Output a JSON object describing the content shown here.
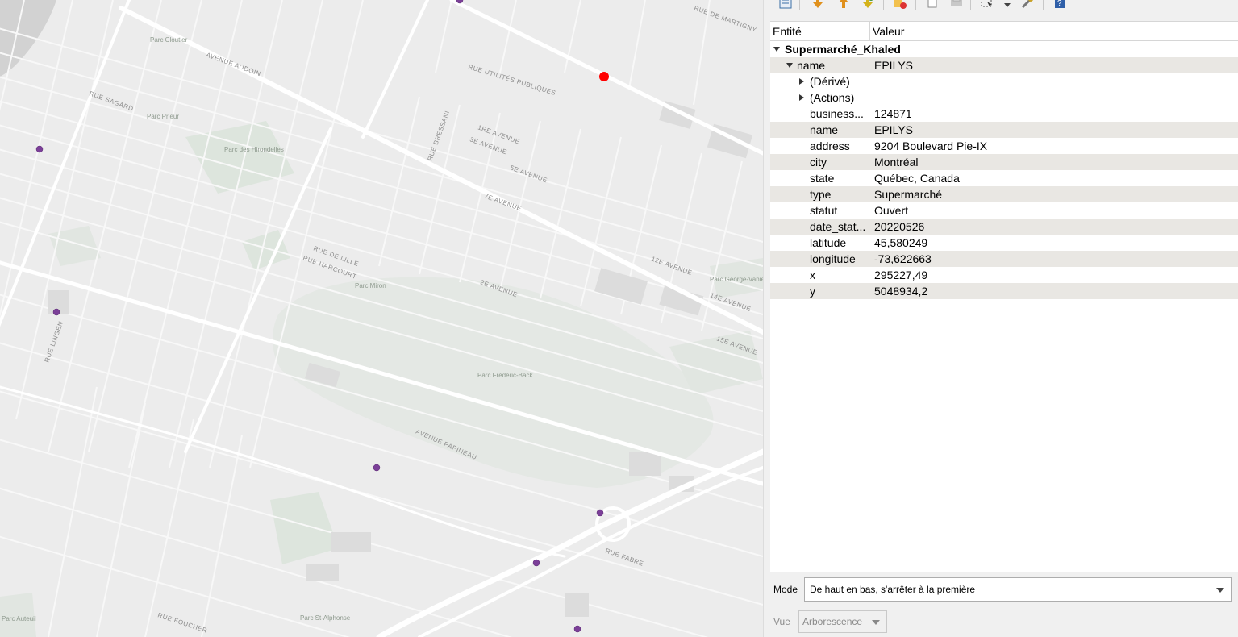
{
  "map": {
    "street_labels": [
      "AVENUE AUDOIN",
      "RUE SAGARD",
      "RUE DE LILLE",
      "RUE HARCOURT",
      "RUE UTILITÉS PUBLIQUES",
      "1RE AVENUE",
      "3E AVENUE",
      "5E AVENUE",
      "12E AVENUE",
      "14E AVENUE",
      "15E AVENUE",
      "AVENUE PAPINEAU",
      "RUE FOUCHER",
      "RUE FABRE",
      "RUE LINGEN",
      "RUE BRESSANI",
      "RUE DE MARTIGNY",
      "7E AVENUE",
      "2E AVENUE"
    ],
    "park_labels": [
      "Parc Cloutier",
      "Parc Prieur",
      "Parc des Hirondelles",
      "Parc Miron",
      "Parc Frédéric-Back",
      "Parc George-Vanier",
      "Parc St-Alphonse",
      "Parc Auteuil"
    ],
    "selected_point_color": "#ff0000",
    "point_color": "#7b3f98"
  },
  "panel": {
    "toolbar_icons": [
      "expand-all-icon",
      "expand-icon",
      "collapse-icon",
      "highlight-icon",
      "clear-highlights-icon",
      "copy-feature-icon",
      "print-icon",
      "select-features-icon",
      "settings-icon",
      "help-icon"
    ],
    "columns": {
      "entity": "Entité",
      "value": "Valeur"
    },
    "layer_name": "Supermarché_Khaled",
    "feature": {
      "key": "name",
      "value": "EPILYS"
    },
    "derived_label": "(Dérivé)",
    "actions_label": "(Actions)",
    "attributes": [
      {
        "key": "business...",
        "value": "124871"
      },
      {
        "key": "name",
        "value": "EPILYS"
      },
      {
        "key": "address",
        "value": "9204   Boulevard Pie-IX"
      },
      {
        "key": "city",
        "value": "Montréal"
      },
      {
        "key": "state",
        "value": "Québec, Canada"
      },
      {
        "key": "type",
        "value": "Supermarché"
      },
      {
        "key": "statut",
        "value": "Ouvert"
      },
      {
        "key": "date_stat...",
        "value": "20220526"
      },
      {
        "key": "latitude",
        "value": "45,580249"
      },
      {
        "key": "longitude",
        "value": "-73,622663"
      },
      {
        "key": "x",
        "value": "295227,49"
      },
      {
        "key": "y",
        "value": "5048934,2"
      }
    ],
    "mode": {
      "label": "Mode",
      "value": "De haut en bas, s'arrêter à la première"
    },
    "view": {
      "label": "Vue",
      "value": "Arborescence"
    }
  }
}
